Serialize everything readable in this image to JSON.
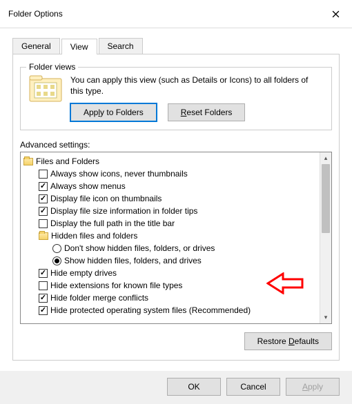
{
  "title": "Folder Options",
  "tabs": {
    "general": "General",
    "view": "View",
    "search": "Search"
  },
  "folder_views": {
    "group_label": "Folder views",
    "desc": "You can apply this view (such as Details or Icons) to all folders of this type.",
    "apply_label": "Apply to Folders",
    "reset_label": "Reset Folders",
    "apply_u": "l",
    "reset_u": "R"
  },
  "advanced_label": "Advanced settings:",
  "tree": {
    "root": "Files and Folders",
    "items": [
      {
        "label": "Always show icons, never thumbnails",
        "checked": false
      },
      {
        "label": "Always show menus",
        "checked": true
      },
      {
        "label": "Display file icon on thumbnails",
        "checked": true
      },
      {
        "label": "Display file size information in folder tips",
        "checked": true
      },
      {
        "label": "Display the full path in the title bar",
        "checked": false
      }
    ],
    "hidden_group": "Hidden files and folders",
    "radios": [
      {
        "label": "Don't show hidden files, folders, or drives",
        "checked": false
      },
      {
        "label": "Show hidden files, folders, and drives",
        "checked": true
      }
    ],
    "items2": [
      {
        "label": "Hide empty drives",
        "checked": true
      },
      {
        "label": "Hide extensions for known file types",
        "checked": false
      },
      {
        "label": "Hide folder merge conflicts",
        "checked": true
      },
      {
        "label": "Hide protected operating system files (Recommended)",
        "checked": true
      }
    ]
  },
  "restore_label": "Restore Defaults",
  "restore_u": "D",
  "buttons": {
    "ok": "OK",
    "cancel": "Cancel",
    "apply": "Apply",
    "apply_u": "A"
  }
}
